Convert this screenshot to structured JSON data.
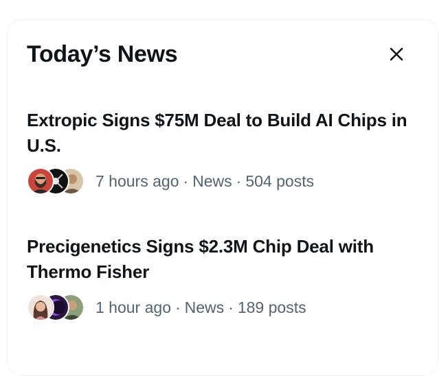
{
  "panel": {
    "title": "Today’s News",
    "close_icon": "close-icon"
  },
  "news": [
    {
      "headline": "Extropic Signs $75M Deal to Build AI Chips in U.S.",
      "time": "7 hours ago",
      "category": "News",
      "posts": "504 posts",
      "separator": "·",
      "avatars": [
        "avatar-man-red-background",
        "avatar-dark-logo",
        "avatar-person-beige"
      ]
    },
    {
      "headline": "Precigenetics Signs $2.3M Chip Deal with Thermo Fisher",
      "time": "1 hour ago",
      "category": "News",
      "posts": "189 posts",
      "separator": "·",
      "avatars": [
        "avatar-woman-light",
        "avatar-purple-orb",
        "avatar-man-green"
      ]
    }
  ],
  "colors": {
    "text_primary": "#0f1419",
    "text_secondary": "#536471",
    "border": "#eff3f4"
  }
}
